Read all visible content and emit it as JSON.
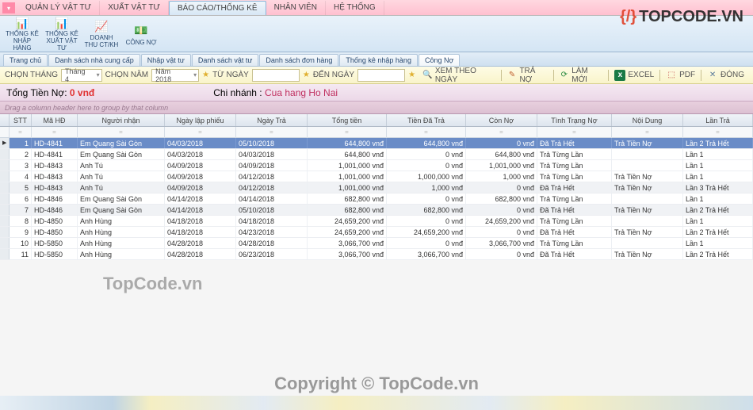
{
  "watermarks": {
    "logo_prefix": "{/}",
    "logo_text": "TOPCODE.VN",
    "mid": "TopCode.vn",
    "center": "Copyright © TopCode.vn"
  },
  "main_tabs": {
    "items": [
      {
        "label": "QUẢN LÝ VẬT TƯ"
      },
      {
        "label": "XUẤT VẬT TƯ"
      },
      {
        "label": "BÁO CÁO/THỐNG KÊ",
        "active": true
      },
      {
        "label": "NHÂN VIÊN"
      },
      {
        "label": "HỆ THỐNG"
      }
    ]
  },
  "ribbon": {
    "items": [
      {
        "label": "THỐNG KÊ NHẬP HÀNG",
        "icon": "📊",
        "name": "ribbon-thongke-nhap"
      },
      {
        "label": "THỐNG KÊ XUẤT VẬT TƯ",
        "icon": "📊",
        "name": "ribbon-thongke-xuat"
      },
      {
        "label": "DOANH THU CT/KH",
        "icon": "📈",
        "name": "ribbon-doanhthu"
      },
      {
        "label": "CÔNG NỢ",
        "icon": "💵",
        "name": "ribbon-congno"
      }
    ]
  },
  "sub_tabs": {
    "items": [
      {
        "label": "Trang chủ"
      },
      {
        "label": "Danh sách nhà cung cấp"
      },
      {
        "label": "Nhập vật tư"
      },
      {
        "label": "Danh sách vật tư"
      },
      {
        "label": "Danh sách đơn hàng"
      },
      {
        "label": "Thống kê nhập hàng"
      },
      {
        "label": "Công Nợ",
        "active": true
      }
    ]
  },
  "filter": {
    "month_label": "CHỌN THÁNG",
    "month_value": "Tháng 4",
    "year_label": "CHỌN NĂM",
    "year_value": "Năm 2018",
    "from_label": "TỪ NGÀY",
    "to_label": "ĐẾN NGÀY",
    "buttons": [
      {
        "label": "XEM THEO NGÀY",
        "icon": "🔍",
        "color": "#4a80c0",
        "name": "btn-xemtheongay"
      },
      {
        "label": "TRẢ NỢ",
        "icon": "✎",
        "color": "#c06030",
        "name": "btn-trano"
      },
      {
        "label": "LÀM MỚI",
        "icon": "⟳",
        "color": "#2a8a40",
        "name": "btn-lammoi"
      },
      {
        "label": "EXCEL",
        "icon": "x",
        "color": "#fff",
        "bg": "#1a7a45",
        "name": "btn-excel"
      },
      {
        "label": "PDF",
        "icon": "⬚",
        "color": "#c04040",
        "name": "btn-pdf"
      },
      {
        "label": "ĐÓNG",
        "icon": "✕",
        "color": "#5a7a9a",
        "name": "btn-dong"
      }
    ]
  },
  "summary": {
    "debt_label": "Tổng Tiền Nợ:",
    "debt_value": "0 vnđ",
    "branch_label": "Chi nhánh :",
    "branch_value": "Cua hang Ho Nai"
  },
  "group_hint": "Drag a column header here to group by that column",
  "columns": [
    "",
    "STT",
    "Mã HĐ",
    "Người nhận",
    "Ngày lập phiếu",
    "Ngày Trả",
    "Tổng tiền",
    "Tiền Đã Trả",
    "Còn Nợ",
    "Tình Trạng Nợ",
    "Nội Dung",
    "Lần Trả"
  ],
  "filter_row_marker": "=",
  "rows": [
    {
      "sel": true,
      "stt": "1",
      "mahd": "HD-4841",
      "nguoi": "Em Quang Sài Gòn",
      "lap": "04/03/2018",
      "tra": "05/10/2018",
      "tong": "644,800 vnđ",
      "datra": "644,800 vnđ",
      "conno": "0 vnđ",
      "trang": "Đã Trả Hết",
      "nd": "Trả Tiền Nợ",
      "lan": "Lần 2 Trả Hết"
    },
    {
      "stt": "2",
      "mahd": "HD-4841",
      "nguoi": "Em Quang Sài Gòn",
      "lap": "04/03/2018",
      "tra": "04/03/2018",
      "tong": "644,800 vnđ",
      "datra": "0 vnđ",
      "conno": "644,800 vnđ",
      "trang": "Trả Từng Lần",
      "nd": "",
      "lan": "Lần 1"
    },
    {
      "stt": "3",
      "mahd": "HD-4843",
      "nguoi": "Anh Tú",
      "lap": "04/09/2018",
      "tra": "04/09/2018",
      "tong": "1,001,000 vnđ",
      "datra": "0 vnđ",
      "conno": "1,001,000 vnđ",
      "trang": "Trả Từng Lần",
      "nd": "",
      "lan": "Lần 1"
    },
    {
      "stt": "4",
      "mahd": "HD-4843",
      "nguoi": "Anh Tú",
      "lap": "04/09/2018",
      "tra": "04/12/2018",
      "tong": "1,001,000 vnđ",
      "datra": "1,000,000 vnđ",
      "conno": "1,000 vnđ",
      "trang": "Trả Từng Lần",
      "nd": "Trả Tiền Nợ",
      "lan": "Lần 1"
    },
    {
      "alt": true,
      "stt": "5",
      "mahd": "HD-4843",
      "nguoi": "Anh Tú",
      "lap": "04/09/2018",
      "tra": "04/12/2018",
      "tong": "1,001,000 vnđ",
      "datra": "1,000 vnđ",
      "conno": "0 vnđ",
      "trang": "Đã Trả Hết",
      "nd": "Trả Tiền Nợ",
      "lan": "Lần 3 Trả Hết"
    },
    {
      "stt": "6",
      "mahd": "HD-4846",
      "nguoi": "Em Quang Sài Gòn",
      "lap": "04/14/2018",
      "tra": "04/14/2018",
      "tong": "682,800 vnđ",
      "datra": "0 vnđ",
      "conno": "682,800 vnđ",
      "trang": "Trả Từng Lần",
      "nd": "",
      "lan": "Lần 1"
    },
    {
      "alt": true,
      "stt": "7",
      "mahd": "HD-4846",
      "nguoi": "Em Quang Sài Gòn",
      "lap": "04/14/2018",
      "tra": "05/10/2018",
      "tong": "682,800 vnđ",
      "datra": "682,800 vnđ",
      "conno": "0 vnđ",
      "trang": "Đã Trả Hết",
      "nd": "Trả Tiền Nợ",
      "lan": "Lần 2 Trả Hết"
    },
    {
      "stt": "8",
      "mahd": "HD-4850",
      "nguoi": "Anh Hùng",
      "lap": "04/18/2018",
      "tra": "04/18/2018",
      "tong": "24,659,200 vnđ",
      "datra": "0 vnđ",
      "conno": "24,659,200 vnđ",
      "trang": "Trả Từng Lần",
      "nd": "",
      "lan": "Lần 1"
    },
    {
      "stt": "9",
      "mahd": "HD-4850",
      "nguoi": "Anh Hùng",
      "lap": "04/18/2018",
      "tra": "04/23/2018",
      "tong": "24,659,200 vnđ",
      "datra": "24,659,200 vnđ",
      "conno": "0 vnđ",
      "trang": "Đã Trả Hết",
      "nd": "Trả Tiền Nợ",
      "lan": "Lần 2 Trả Hết"
    },
    {
      "stt": "10",
      "mahd": "HD-5850",
      "nguoi": "Anh Hùng",
      "lap": "04/28/2018",
      "tra": "04/28/2018",
      "tong": "3,066,700 vnđ",
      "datra": "0 vnđ",
      "conno": "3,066,700 vnđ",
      "trang": "Trả Từng Lần",
      "nd": "",
      "lan": "Lần 1"
    },
    {
      "stt": "11",
      "mahd": "HD-5850",
      "nguoi": "Anh Hùng",
      "lap": "04/28/2018",
      "tra": "06/23/2018",
      "tong": "3,066,700 vnđ",
      "datra": "3,066,700 vnđ",
      "conno": "0 vnđ",
      "trang": "Đã Trả Hết",
      "nd": "Trả Tiền Nợ",
      "lan": "Lần 2 Trả Hết"
    }
  ]
}
